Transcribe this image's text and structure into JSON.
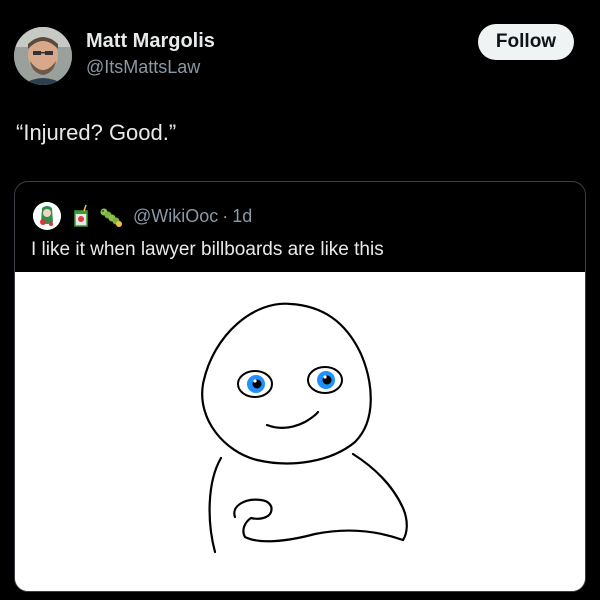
{
  "tweet": {
    "display_name": "Matt Margolis",
    "handle": "@ItsMattsLaw",
    "follow_label": "Follow",
    "text": "“Injured? Good.”"
  },
  "quote": {
    "handle": "@WikiOoc",
    "separator": "·",
    "time": "1d",
    "text": "I like it when lawyer billboards are like this",
    "emoji_icons": [
      "juice-box-icon",
      "caterpillar-icon"
    ]
  },
  "colors": {
    "background": "#000000",
    "text_primary": "#e7e9ea",
    "text_secondary": "#8b98a5",
    "follow_bg": "#eff3f4",
    "card_border": "#3a3f45",
    "eye_blue": "#1e90ff"
  }
}
